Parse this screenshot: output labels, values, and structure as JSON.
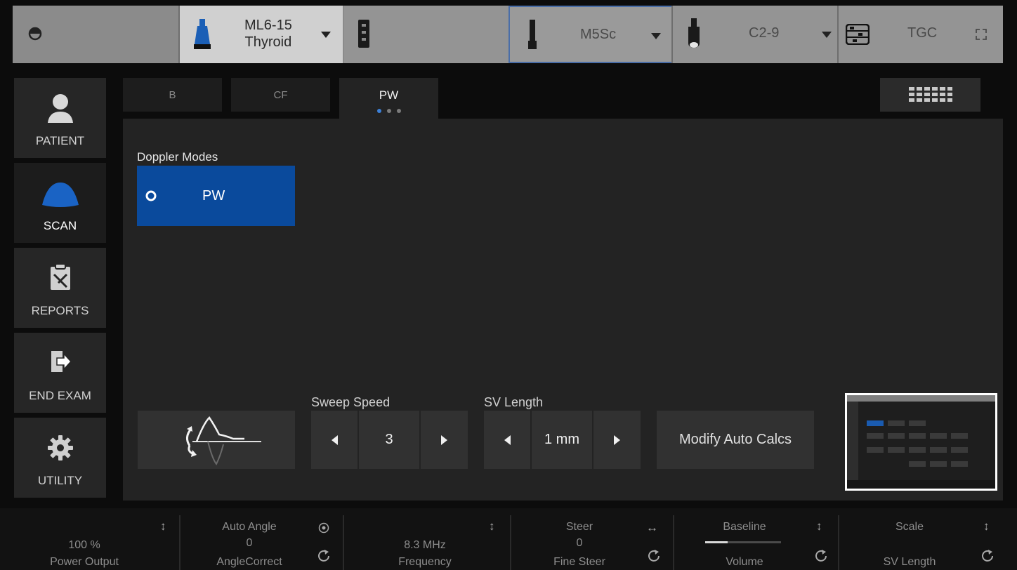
{
  "probes": [
    {
      "name": "ML6-15",
      "preset": "Thyroid",
      "icon": "linear-probe-icon"
    },
    {
      "name": "",
      "preset": "",
      "icon": "remote-probe-icon"
    },
    {
      "name": "M5Sc",
      "preset": "",
      "icon": "sector-probe-icon"
    },
    {
      "name": "C2-9",
      "preset": "",
      "icon": "convex-probe-icon"
    },
    {
      "name": "TGC",
      "preset": "",
      "icon": "tgc-icon"
    }
  ],
  "nav": {
    "patient": "PATIENT",
    "scan": "SCAN",
    "reports": "REPORTS",
    "end_exam": "END EXAM",
    "utility": "UTILITY"
  },
  "tabs": [
    "B",
    "CF",
    "PW"
  ],
  "doppler": {
    "section_label": "Doppler Modes",
    "pw_label": "PW"
  },
  "sweep_speed": {
    "label": "Sweep Speed",
    "value": "3"
  },
  "sv_length": {
    "label": "SV Length",
    "value": "1 mm"
  },
  "modify_auto_calcs": "Modify Auto Calcs",
  "rotaries": [
    {
      "top": "",
      "value": "100 %",
      "label": "Power Output"
    },
    {
      "top": "Auto Angle",
      "value": "0",
      "label": "AngleCorrect"
    },
    {
      "top": "",
      "value": "8.3 MHz",
      "label": "Frequency"
    },
    {
      "top": "Steer",
      "value": "0",
      "label": "Fine Steer"
    },
    {
      "top": "Baseline",
      "value": "",
      "label": "Volume"
    },
    {
      "top": "Scale",
      "value": "",
      "label": "SV Length"
    }
  ],
  "colors": {
    "accent": "#0a4a9c",
    "panel": "#232323",
    "probe_bar": "#8b8b8b",
    "selected_probe": "#d0d0d0"
  }
}
